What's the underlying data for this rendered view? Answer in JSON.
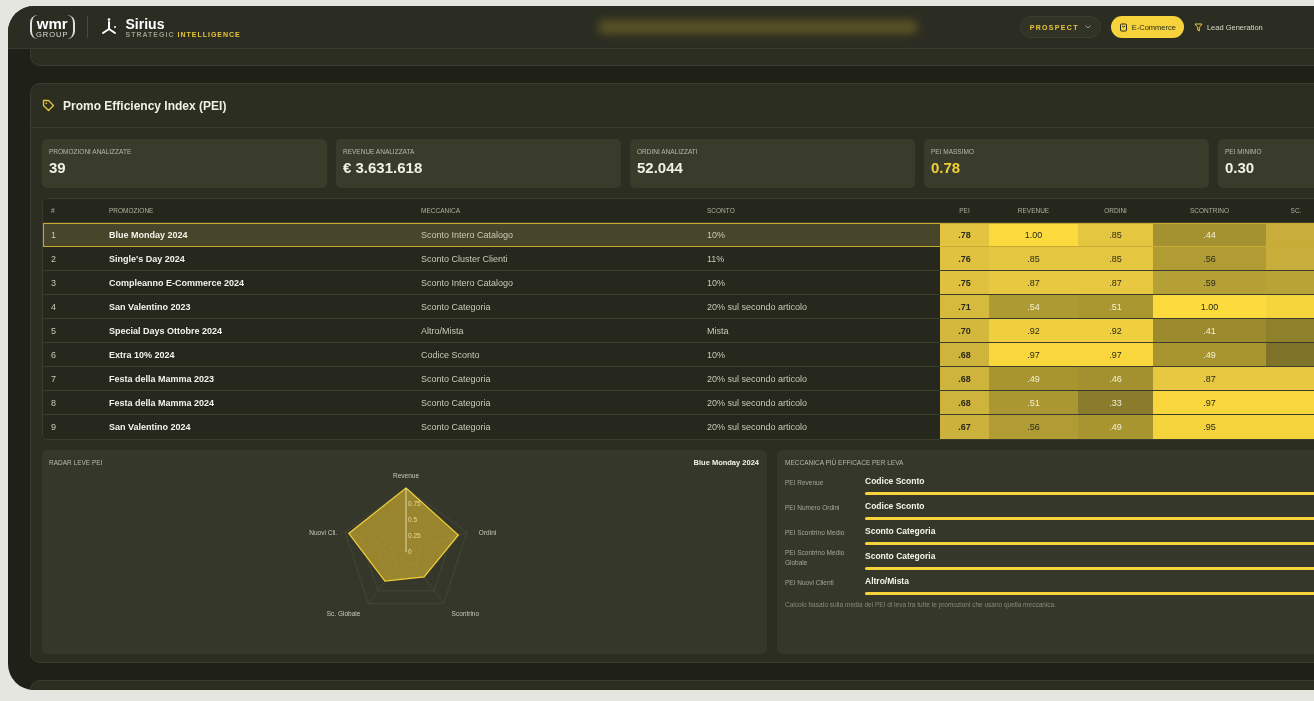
{
  "header": {
    "logo": {
      "mark": "wmr",
      "sub": "GROUP"
    },
    "brand": {
      "name": "Sirius",
      "tagline_a": "STRATEGIC",
      "tagline_b": "INTELLIGENCE"
    },
    "segment": {
      "label": "PROSPECT"
    },
    "tabs": [
      {
        "label": "E-Commerce",
        "selected": true
      },
      {
        "label": "Lead Generation",
        "selected": false
      }
    ]
  },
  "section": {
    "title": "Promo Efficiency Index (PEI)",
    "kpis": [
      {
        "label": "PROMOZIONI ANALIZZATE",
        "value": "39",
        "highlight": false
      },
      {
        "label": "REVENUE ANALIZZATA",
        "value": "€ 3.631.618",
        "highlight": false
      },
      {
        "label": "ORDINI ANALIZZATI",
        "value": "52.044",
        "highlight": false
      },
      {
        "label": "PEI MASSIMO",
        "value": "0.78",
        "highlight": true
      },
      {
        "label": "PEI MINIMO",
        "value": "0.30",
        "highlight": false
      }
    ],
    "table": {
      "columns": [
        "#",
        "PROMOZIONE",
        "MECCANICA",
        "SCONTO",
        "PEI",
        "REVENUE",
        "ORDINI",
        "SCONTRINO",
        "SC."
      ],
      "rows": [
        {
          "n": "1",
          "promo": "Blue Monday 2024",
          "mech": "Sconto Intero Catalogo",
          "discount": "10%",
          "selected": true,
          "heat": [
            {
              "text": ".78",
              "color": "#e3c440"
            },
            {
              "text": "1.00",
              "color": "#fcd93c"
            },
            {
              "text": ".85",
              "color": "#e5c640"
            },
            {
              "text": ".44",
              "color": "#a3922f"
            },
            {
              "color": "#c8ad3a"
            }
          ]
        },
        {
          "n": "2",
          "promo": "Single's Day 2024",
          "mech": "Sconto Cluster Clienti",
          "discount": "11%",
          "selected": false,
          "heat": [
            {
              "text": ".76",
              "color": "#e0c240"
            },
            {
              "text": ".85",
              "color": "#e5c640"
            },
            {
              "text": ".85",
              "color": "#e5c640"
            },
            {
              "text": ".56",
              "color": "#b09c33"
            },
            {
              "color": "#c8ad3a"
            }
          ]
        },
        {
          "n": "3",
          "promo": "Compleanno E-Commerce 2024",
          "mech": "Sconto Intero Catalogo",
          "discount": "10%",
          "selected": false,
          "heat": [
            {
              "text": ".75",
              "color": "#dfc13f"
            },
            {
              "text": ".87",
              "color": "#e8c840"
            },
            {
              "text": ".87",
              "color": "#e8c840"
            },
            {
              "text": ".59",
              "color": "#b5a035"
            },
            {
              "color": "#b9a236"
            }
          ]
        },
        {
          "n": "4",
          "promo": "San Valentino 2023",
          "mech": "Sconto Categoria",
          "discount": "20% sul secondo articolo",
          "selected": false,
          "heat": [
            {
              "text": ".71",
              "color": "#d6ba3e"
            },
            {
              "text": ".54",
              "color": "#ae9a33"
            },
            {
              "text": ".51",
              "color": "#a9962f"
            },
            {
              "text": "1.00",
              "color": "#fcd93c"
            },
            {
              "color": "#f5d33b"
            }
          ]
        },
        {
          "n": "5",
          "promo": "Special Days Ottobre 2024",
          "mech": "Altro/Mista",
          "discount": "Mista",
          "selected": false,
          "heat": [
            {
              "text": ".70",
              "color": "#d4b83d"
            },
            {
              "text": ".92",
              "color": "#f0cf3e"
            },
            {
              "text": ".92",
              "color": "#f0cf3e"
            },
            {
              "text": ".41",
              "color": "#9c8b2e"
            },
            {
              "color": "#8f812c"
            }
          ]
        },
        {
          "n": "6",
          "promo": "Extra 10% 2024",
          "mech": "Codice Sconto",
          "discount": "10%",
          "selected": false,
          "heat": [
            {
              "text": ".68",
              "color": "#cfb43c"
            },
            {
              "text": ".97",
              "color": "#f8d63c"
            },
            {
              "text": ".97",
              "color": "#f8d63c"
            },
            {
              "text": ".49",
              "color": "#a89530"
            },
            {
              "color": "#7e7329"
            }
          ]
        },
        {
          "n": "7",
          "promo": "Festa della Mamma 2023",
          "mech": "Sconto Categoria",
          "discount": "20% sul secondo articolo",
          "selected": false,
          "heat": [
            {
              "text": ".68",
              "color": "#cfb43c"
            },
            {
              "text": ".49",
              "color": "#a89530"
            },
            {
              "text": ".46",
              "color": "#a3912f"
            },
            {
              "text": ".87",
              "color": "#e8c840"
            },
            {
              "color": "#e8c840"
            }
          ]
        },
        {
          "n": "8",
          "promo": "Festa della Mamma 2024",
          "mech": "Sconto Categoria",
          "discount": "20% sul secondo articolo",
          "selected": false,
          "heat": [
            {
              "text": ".68",
              "color": "#cfb43c"
            },
            {
              "text": ".51",
              "color": "#aa9731"
            },
            {
              "text": ".33",
              "color": "#8a7c2c"
            },
            {
              "text": ".97",
              "color": "#f8d63c"
            },
            {
              "color": "#f8d63c"
            }
          ]
        },
        {
          "n": "9",
          "promo": "San Valentino 2024",
          "mech": "Sconto Categoria",
          "discount": "20% sul secondo articolo",
          "selected": false,
          "heat": [
            {
              "text": ".67",
              "color": "#ccb13c"
            },
            {
              "text": ".56",
              "color": "#b09c33"
            },
            {
              "text": ".49",
              "color": "#a89530"
            },
            {
              "text": ".95",
              "color": "#f5d33c"
            },
            {
              "color": "#f5d33c"
            }
          ]
        }
      ]
    },
    "radar": {
      "title": "RADAR LEVE PEI",
      "promotion": "Blue Monday 2024",
      "axes": [
        "Revenue",
        "Ordini",
        "Scontrino",
        "Sc. Globale",
        "Nuovi Cli."
      ],
      "ticks": [
        "0.75",
        "0.5",
        "0.25",
        "0"
      ]
    },
    "best": {
      "title": "MECCANICA PIÙ EFFICACE PER LEVA",
      "rows": [
        {
          "lever": "PEI Revenue",
          "mechanic": "Codice Sconto",
          "level": 1
        },
        {
          "lever": "PEI Numero Ordini",
          "mechanic": "Codice Sconto",
          "level": 1
        },
        {
          "lever": "PEI Scontrino Medio",
          "mechanic": "Sconto Categoria",
          "level": 1
        },
        {
          "lever": "PEI Scontrino Medio Globale",
          "mechanic": "Sconto Categoria",
          "level": 1
        },
        {
          "lever": "PEI Nuovi Clienti",
          "mechanic": "Altro/Mista",
          "level": 1
        }
      ],
      "note": "Calcolo basato sulla media del PEI di leva tra tutte le promozioni che usano quella meccanica."
    }
  }
}
